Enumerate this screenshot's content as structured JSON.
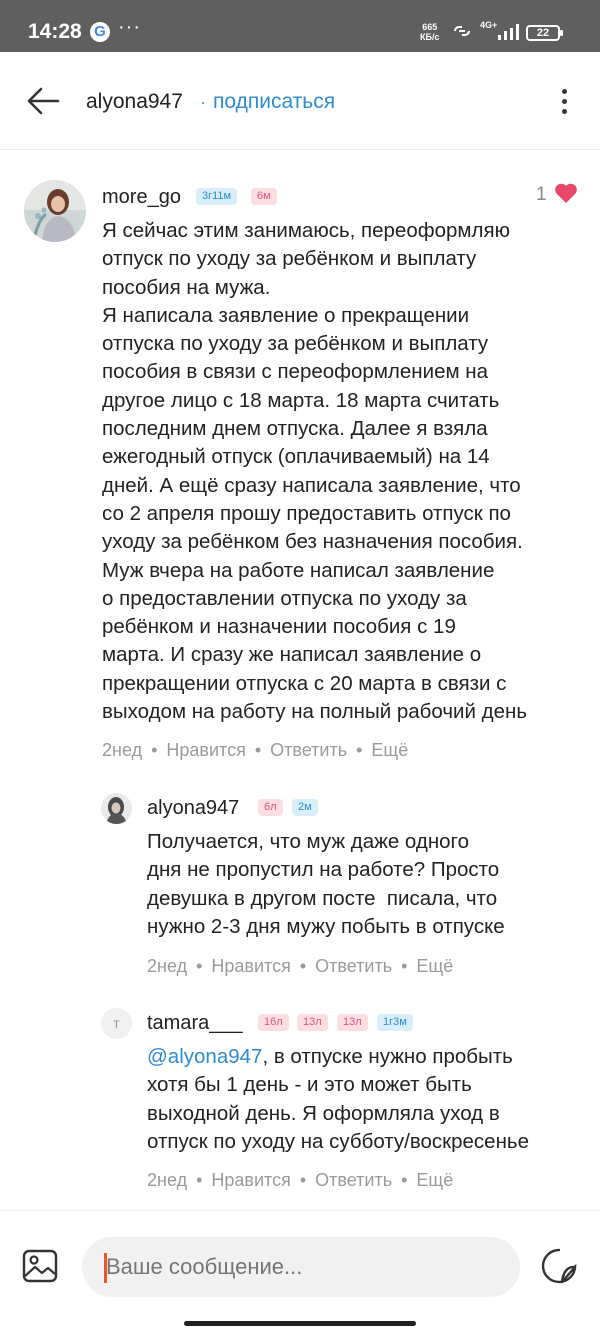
{
  "status_bar": {
    "time": "14:28",
    "speed_value": "665",
    "speed_unit": "КБ/с",
    "network": "4G+",
    "battery": "22"
  },
  "header": {
    "title": "alyona947",
    "separator": "·",
    "subscribe_label": "подписаться"
  },
  "comments": [
    {
      "username": "more_go",
      "badges": [
        "3г11м",
        "6м"
      ],
      "likes": "1",
      "text": "Я сейчас этим занимаюсь, переоформляю\nотпуск по уходу за ребёнком и выплату\nпособия на мужа.\nЯ написала заявление о прекращении\nотпуска по уходу за ребёнком и выплату\nпособия в связи с переоформлением на\nдругое лицо с 18 марта. 18 марта считать\nпоследним днем отпуска. Далее я взяла\nежегодный отпуск (оплачиваемый) на 14\nдней. А ещё сразу написала заявление, что\nсо 2 апреля прошу предоставить отпуск по\nуходу за ребёнком без назначения пособия.\nМуж вчера на работе написал заявление\nо предоставлении отпуска по уходу за\nребёнком и назначении пособия с 19\nмарта. И сразу же написал заявление о\nпрекращении отпуска с 20 марта в связи с\nвыходом на работу на полный рабочий день",
      "time": "2нед",
      "like_label": "Нравится",
      "reply_label": "Ответить",
      "more_label": "Ещё"
    },
    {
      "username": "alyona947",
      "badges": [
        "6л",
        "2м"
      ],
      "text": "Получается, что муж даже одного\nдня не пропустил на работе? Просто\nдевушка в другом посте  писала, что\nнужно 2-3 дня мужу побыть в отпуске",
      "time": "2нед",
      "like_label": "Нравится",
      "reply_label": "Ответить",
      "more_label": "Ещё"
    },
    {
      "username": "tamara___",
      "avatar_letter": "т",
      "badges": [
        "16л",
        "13л",
        "13л",
        "1г3м"
      ],
      "mention": "@alyona947",
      "text_line1_rest": ", в отпуске нужно пробыть",
      "text_rest": "хотя бы 1 день - и это может быть\nвыходной день. Я оформляла уход в\nотпуск по уходу на субботу/воскресенье",
      "time": "2нед",
      "like_label": "Нравится",
      "reply_label": "Ответить",
      "more_label": "Ещё"
    }
  ],
  "composer": {
    "placeholder": "Ваше сообщение..."
  },
  "colors": {
    "accent": "#2f8bd0",
    "heart": "#e8476a",
    "status_bar": "#5f5f5f"
  },
  "icons": [
    "back-arrow-icon",
    "more-vertical-icon",
    "heart-icon",
    "image-icon",
    "sticker-icon"
  ]
}
